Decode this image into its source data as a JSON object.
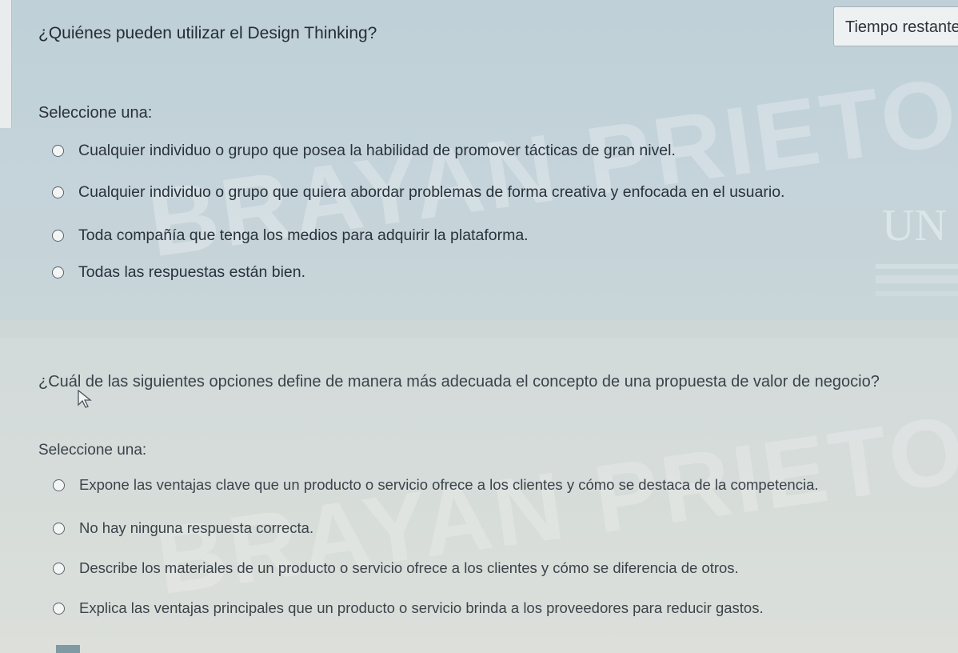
{
  "timer": {
    "label": "Tiempo restante"
  },
  "watermark": {
    "text": "BRAYAN PRIETO REINA"
  },
  "questions": [
    {
      "text": "¿Quiénes pueden utilizar el Design Thinking?",
      "select_label": "Seleccione una:",
      "options": [
        "Cualquier individuo o grupo que posea la habilidad de promover tácticas de gran nivel.",
        "Cualquier individuo o grupo que quiera abordar problemas de forma creativa y enfocada en el usuario.",
        "Toda compañía que tenga los medios para adquirir la plataforma.",
        "Todas las respuestas están bien."
      ]
    },
    {
      "text": "¿Cuál de las siguientes opciones define de manera más adecuada el concepto de una propuesta de valor de negocio?",
      "select_label": "Seleccione una:",
      "options": [
        "Expone las ventajas clave que un producto o servicio ofrece a los clientes y cómo se destaca de la competencia.",
        "No hay ninguna respuesta correcta.",
        "Describe los materiales de un producto o servicio ofrece a los clientes y cómo se diferencia de otros.",
        "Explica las ventajas principales que un producto o servicio brinda a los proveedores para reducir gastos."
      ]
    }
  ]
}
